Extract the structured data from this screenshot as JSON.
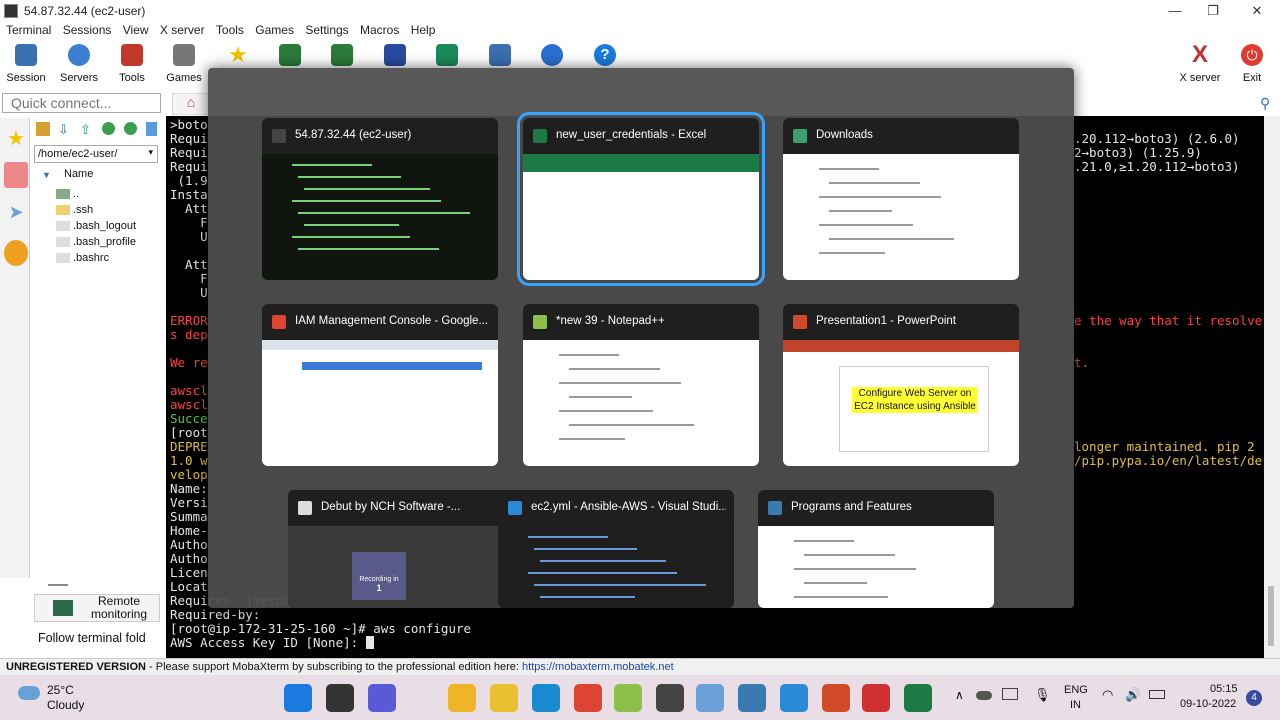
{
  "window": {
    "title": "54.87.32.44 (ec2-user)",
    "minimize": "—",
    "maximize": "❐",
    "close": "✕"
  },
  "menu": [
    "Terminal",
    "Sessions",
    "View",
    "X server",
    "Tools",
    "Games",
    "Settings",
    "Macros",
    "Help"
  ],
  "toolbar": {
    "buttons": [
      {
        "label": "Session",
        "icon": "session-icon",
        "color": "#3a6fb0"
      },
      {
        "label": "Servers",
        "icon": "servers-icon",
        "color": "#3a7fd0"
      },
      {
        "label": "Tools",
        "icon": "tools-icon",
        "color": "#c0392b"
      },
      {
        "label": "Games",
        "icon": "games-icon",
        "color": "#666666"
      },
      {
        "label": "",
        "icon": "star-icon",
        "color": "#f2c200"
      },
      {
        "label": "",
        "icon": "monitor-icon",
        "color": "#2a7a3a"
      },
      {
        "label": "",
        "icon": "split-icon",
        "color": "#2a7a3a"
      },
      {
        "label": "",
        "icon": "fork-icon",
        "color": "#2a4aa0"
      },
      {
        "label": "",
        "icon": "transfer-icon",
        "color": "#1a8a5a"
      },
      {
        "label": "",
        "icon": "download-icon",
        "color": "#3a6fb0"
      },
      {
        "label": "",
        "icon": "settings-icon",
        "color": "#2a6fd0"
      },
      {
        "label": "",
        "icon": "help-icon",
        "color": "#1a7ae0"
      }
    ],
    "xserver_label": "X server",
    "exit_label": "Exit"
  },
  "left": {
    "quick_connect_placeholder": "Quick connect...",
    "path": "/home/ec2-user/",
    "tree_header": "Name",
    "files": [
      "..",
      ".ssh",
      ".bash_logout",
      ".bash_profile",
      ".bashrc"
    ],
    "remote_monitoring": "Remote monitoring",
    "follow_terminal": "Follow terminal fold"
  },
  "terminal": {
    "left_lines": [
      {
        "text": ">boto",
        "color": "#e6e6e6"
      },
      {
        "text": "Requi",
        "color": "#e6e6e6"
      },
      {
        "text": "Requi",
        "color": "#e6e6e6"
      },
      {
        "text": "Requi",
        "color": "#e6e6e6"
      },
      {
        "text": " (1.9",
        "color": "#e6e6e6"
      },
      {
        "text": "Insta",
        "color": "#e6e6e6"
      },
      {
        "text": "  Att",
        "color": "#e6e6e6"
      },
      {
        "text": "    F",
        "color": "#e6e6e6"
      },
      {
        "text": "    U",
        "color": "#e6e6e6"
      },
      {
        "text": "",
        "color": "#e6e6e6"
      },
      {
        "text": "  Att",
        "color": "#e6e6e6"
      },
      {
        "text": "    F",
        "color": "#e6e6e6"
      },
      {
        "text": "    U",
        "color": "#e6e6e6"
      },
      {
        "text": "",
        "color": "#e6e6e6"
      },
      {
        "text": "ERROR",
        "color": "#ff4040"
      },
      {
        "text": "s dep",
        "color": "#ff4040"
      },
      {
        "text": "",
        "color": "#e6e6e6"
      },
      {
        "text": "We re",
        "color": "#ff4040"
      },
      {
        "text": "",
        "color": "#e6e6e6"
      },
      {
        "text": "awscl",
        "color": "#ff4040"
      },
      {
        "text": "awscl",
        "color": "#ff4040"
      },
      {
        "text": "Succe",
        "color": "#40d040"
      },
      {
        "text": "[root",
        "color": "#e6e6e6"
      },
      {
        "text": "DEPRE",
        "color": "#e0c030"
      },
      {
        "text": "1.0 w",
        "color": "#e0c030"
      },
      {
        "text": "velop",
        "color": "#e0c030"
      },
      {
        "text": "Name:",
        "color": "#e6e6e6"
      },
      {
        "text": "Versi",
        "color": "#e6e6e6"
      },
      {
        "text": "Summa",
        "color": "#e6e6e6"
      },
      {
        "text": "Home-",
        "color": "#e6e6e6"
      },
      {
        "text": "Autho",
        "color": "#e6e6e6"
      },
      {
        "text": "Autho",
        "color": "#e6e6e6"
      },
      {
        "text": "Licen",
        "color": "#e6e6e6"
      },
      {
        "text": "Locat",
        "color": "#e6e6e6"
      },
      {
        "text": "Requires: jmespath, s3transfer, botocore",
        "color": "#e6e6e6"
      },
      {
        "text": "Required-by:",
        "color": "#e6e6e6"
      },
      {
        "text": "[root@ip-172-31-25-160 ~]# aws configure",
        "color": "#e6e6e6"
      },
      {
        "text": "AWS Access Key ID [None]: ",
        "color": "#e6e6e6"
      }
    ],
    "right_lines": [
      {
        "text": ".20.112→boto3) (2.6.0)",
        "color": "#e6e6e6",
        "row": 1
      },
      {
        "text": "2→boto3) (1.25.9)",
        "color": "#e6e6e6",
        "row": 2
      },
      {
        "text": ".21.0,≥1.20.112→boto3)",
        "color": "#e6e6e6",
        "row": 3
      },
      {
        "text": "e the way that it resolve",
        "color": "#ff4040",
        "row": 14
      },
      {
        "text": "t.",
        "color": "#ff4040",
        "row": 17
      },
      {
        "text": "longer maintained. pip 2",
        "color": "#e0c030",
        "row": 23
      },
      {
        "text": "/pip.pypa.io/en/latest/de",
        "color": "#e0c030",
        "row": 24
      }
    ]
  },
  "status": {
    "unregistered": "UNREGISTERED VERSION",
    "message": " -  Please support MobaXterm by subscribing to the professional edition here:  ",
    "link": "https://mobaxterm.mobatek.net"
  },
  "taskview": {
    "windows": [
      {
        "title": "54.87.32.44 (ec2-user)",
        "icon": "mobaxterm-icon",
        "icon_color": "#444444",
        "thumb": "terminal",
        "selected": false
      },
      {
        "title": "new_user_credentials - Excel",
        "icon": "excel-icon",
        "icon_color": "#1d7a45",
        "thumb": "excel",
        "selected": true
      },
      {
        "title": "Downloads",
        "icon": "download-folder-icon",
        "icon_color": "#3aa070",
        "thumb": "explorer",
        "selected": false
      },
      {
        "title": "IAM Management Console - Google...",
        "icon": "chrome-icon",
        "icon_color": "#dd4433",
        "thumb": "browser",
        "selected": false
      },
      {
        "title": "*new 39 - Notepad++",
        "icon": "notepadpp-icon",
        "icon_color": "#8cc04a",
        "thumb": "notepad",
        "selected": false
      },
      {
        "title": "Presentation1 - PowerPoint",
        "icon": "powerpoint-icon",
        "icon_color": "#d04a2a",
        "thumb": "ppt",
        "slide_text": "Configure Web Server on EC2 Instance using Ansible",
        "selected": false
      },
      {
        "title": "Debut by NCH Software -...",
        "icon": "debut-icon",
        "icon_color": "#dddddd",
        "thumb": "debut",
        "recording_label": "Recording in",
        "recording_count": "1",
        "selected": false
      },
      {
        "title": "ec2.yml - Ansible-AWS - Visual Studi...",
        "icon": "vscode-icon",
        "icon_color": "#2a8ad8",
        "thumb": "vscode",
        "selected": false
      },
      {
        "title": "Programs and Features",
        "icon": "programs-icon",
        "icon_color": "#3a7ab0",
        "thumb": "programs",
        "selected": false
      }
    ]
  },
  "taskbar": {
    "weather_temp": "25°C",
    "weather_desc": "Cloudy",
    "apps": [
      {
        "icon": "windows-start-icon",
        "color": "#1a7ae0"
      },
      {
        "icon": "search-icon",
        "color": "#333333"
      },
      {
        "icon": "meet-icon",
        "color": "#5a5ad8"
      },
      {
        "icon": "file-explorer-icon",
        "color": "#f0b428"
      },
      {
        "icon": "sticky-notes-icon",
        "color": "#e8c030"
      },
      {
        "icon": "edge-icon",
        "color": "#1a8ad0"
      },
      {
        "icon": "chrome-icon",
        "color": "#dd4433"
      },
      {
        "icon": "notepadpp-icon",
        "color": "#8cc04a"
      },
      {
        "icon": "mobaxterm-icon",
        "color": "#444444"
      },
      {
        "icon": "notepad-icon",
        "color": "#6aa0d8"
      },
      {
        "icon": "remote-desktop-icon",
        "color": "#3a7ab0"
      },
      {
        "icon": "vscode-icon",
        "color": "#2a8ad8"
      },
      {
        "icon": "powerpoint-icon",
        "color": "#d04a2a"
      },
      {
        "icon": "debut-icon",
        "color": "#d03030"
      },
      {
        "icon": "excel-icon",
        "color": "#1d7a45"
      }
    ],
    "lang_top": "ENG",
    "lang_bottom": "IN",
    "time": "05:15",
    "date": "09-10-2022",
    "notifications": "4"
  }
}
